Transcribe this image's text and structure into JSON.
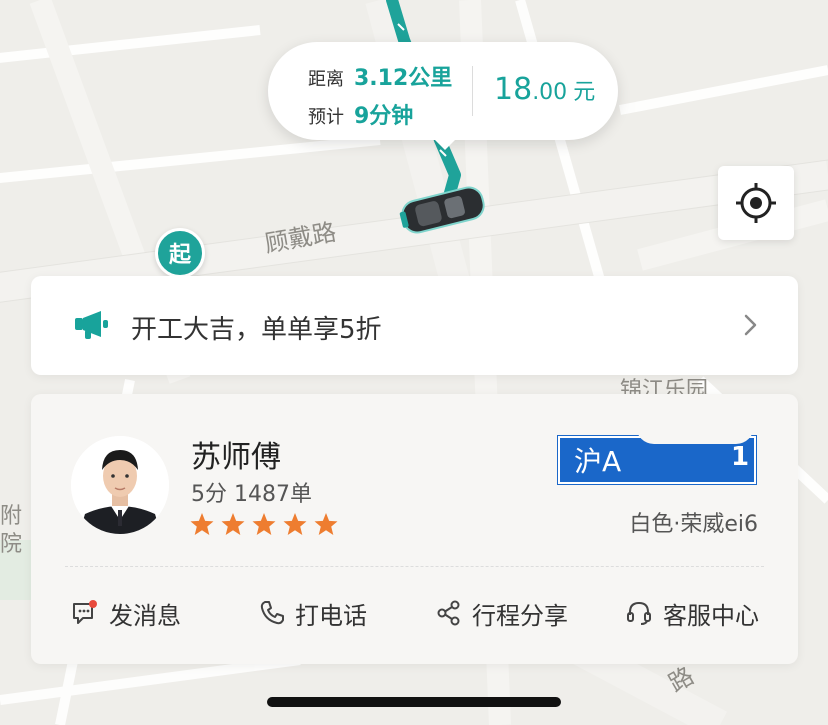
{
  "map": {
    "road_labels": [
      "顾戴路",
      "锦江乐园",
      "路",
      "附",
      "院"
    ],
    "start_marker": "起",
    "route_color": "#1fa39a"
  },
  "trip": {
    "distance_label": "距离",
    "distance_value": "3.12公里",
    "eta_label": "预计",
    "eta_value": "9分钟",
    "price_int": "18",
    "price_dec": ".00",
    "price_unit": "元",
    "accent_color": "#18a39b"
  },
  "locate_button": {
    "icon": "locate-crosshair-icon"
  },
  "promo": {
    "icon": "megaphone-icon",
    "text": "开工大吉，单单享5折"
  },
  "driver": {
    "name": "苏师傅",
    "stats": "5分 1487单",
    "rating_stars": 5,
    "plate": "沪A",
    "plate_end": "1",
    "car_info": "白色·荣威ei6"
  },
  "actions": [
    {
      "label": "发消息",
      "icon": "message-icon",
      "badge": true
    },
    {
      "label": "打电话",
      "icon": "phone-icon"
    },
    {
      "label": "行程分享",
      "icon": "share-icon"
    },
    {
      "label": "客服中心",
      "icon": "headset-icon"
    }
  ]
}
